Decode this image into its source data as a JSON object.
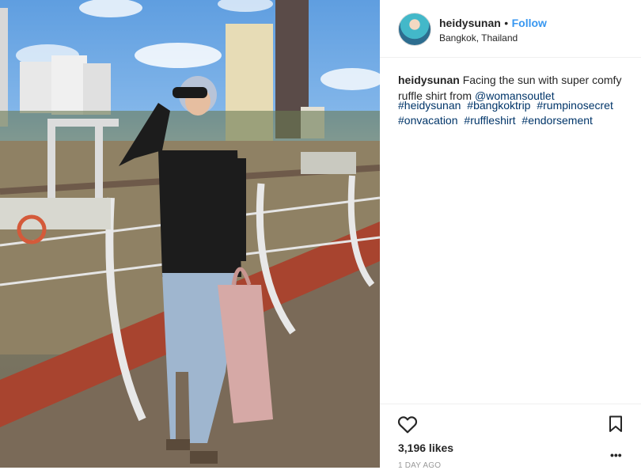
{
  "post": {
    "username": "heidysunan",
    "separator": "•",
    "follow_label": "Follow",
    "location": "Bangkok, Thailand",
    "caption_user": "heidysunan",
    "caption_text": "Facing the sun with super comfy ruffle shirt from",
    "caption_mention": "@womansoutlet",
    "hashtags": [
      "#heidysunan",
      "#bangkoktrip",
      "#rumpinosecret",
      "#onvacation",
      "#ruffleshirt",
      "#endorsement"
    ],
    "likes": "3,196 likes",
    "time_ago": "1 DAY AGO",
    "more_label": "•••"
  },
  "icons": {
    "like": "heart-icon",
    "save": "bookmark-icon",
    "more": "more-options-icon"
  },
  "colors": {
    "link": "#3897f0",
    "hashtag": "#003569",
    "text": "#262626"
  }
}
